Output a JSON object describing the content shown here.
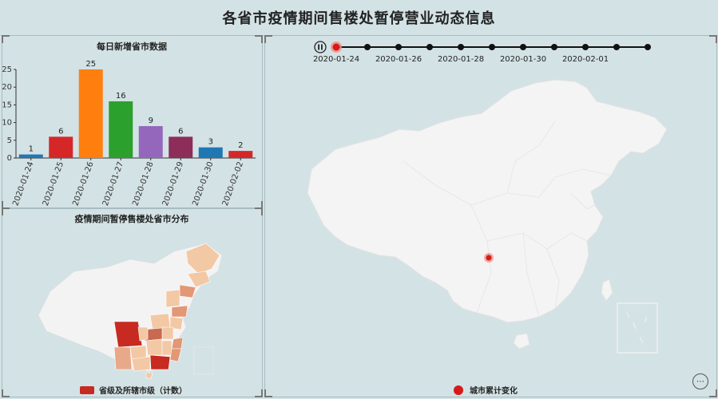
{
  "header": {
    "title": "各省市疫情期间售楼处暂停营业动态信息"
  },
  "bar_panel": {
    "title": "每日新增省市数据"
  },
  "map_small_panel": {
    "title": "疫情期间暂停售楼处省市分布",
    "legend": "省级及所辖市级（计数）"
  },
  "map_main_panel": {
    "legend": "城市累计变化"
  },
  "timeline": {
    "current": "2020-01-24",
    "labels": [
      "2020-01-24",
      "2020-01-26",
      "2020-01-28",
      "2020-01-30",
      "2020-02-01"
    ],
    "points": 11
  },
  "colors": {
    "accent": "#c62a21",
    "timeline_current": "#d61a1a",
    "map_land": "#f3f3f3",
    "map_shade_light": "#f2c8a5",
    "map_shade_mid": "#e29775",
    "map_shade_dark": "#c62a21"
  },
  "chart_data": {
    "type": "bar",
    "categories": [
      "2020-01-24",
      "2020-01-25",
      "2020-01-26",
      "2020-01-27",
      "2020-01-28",
      "2020-01-29",
      "2020-01-30",
      "2020-02-02"
    ],
    "values": [
      1,
      6,
      25,
      16,
      9,
      6,
      3,
      2
    ],
    "colors": [
      "#1f77b4",
      "#d62728",
      "#ff7f0e",
      "#2ca02c",
      "#9467bd",
      "#8c2d5a",
      "#1f77b4",
      "#d62728"
    ],
    "ylim": [
      0,
      25
    ],
    "yticks": [
      0,
      5,
      10,
      15,
      20,
      25
    ],
    "title": "每日新增省市数据",
    "grid": false
  }
}
